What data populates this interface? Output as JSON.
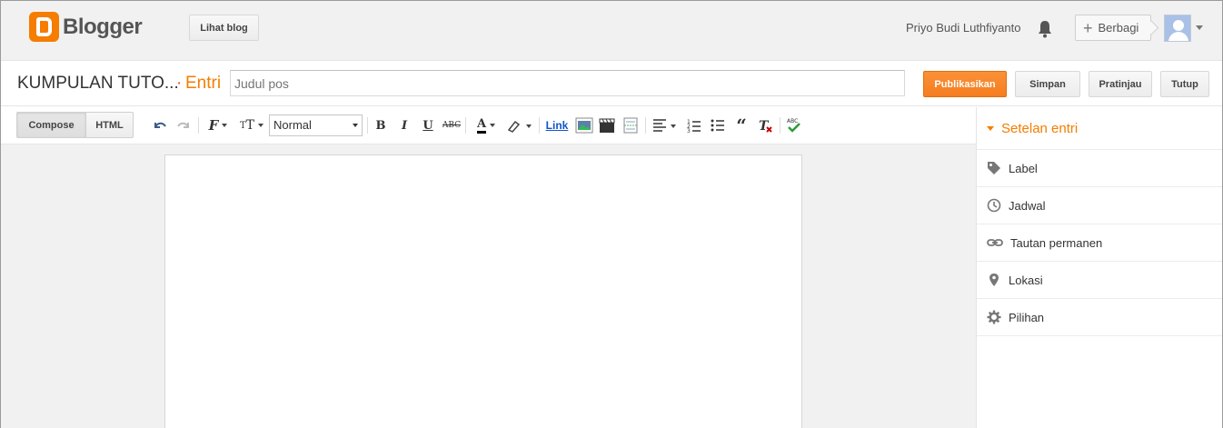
{
  "app": {
    "name": "Blogger"
  },
  "header": {
    "view_blog_label": "Lihat blog",
    "user_name": "Priyo Budi Luthfiyanto",
    "share_label": "Berbagi"
  },
  "post": {
    "blog_name": "KUMPULAN TUTO...",
    "separator": "·",
    "section_label": "Entri",
    "title_placeholder": "Judul pos",
    "publish_label": "Publikasikan",
    "save_label": "Simpan",
    "preview_label": "Pratinjau",
    "close_label": "Tutup"
  },
  "toolbar": {
    "compose_label": "Compose",
    "html_label": "HTML",
    "font_size_value": "Normal",
    "link_label": "Link"
  },
  "sidebar": {
    "title": "Setelan entri",
    "items": [
      {
        "label": "Label",
        "icon": "tag-icon"
      },
      {
        "label": "Jadwal",
        "icon": "clock-icon"
      },
      {
        "label": "Tautan permanen",
        "icon": "link-icon"
      },
      {
        "label": "Lokasi",
        "icon": "location-pin-icon"
      },
      {
        "label": "Pilihan",
        "icon": "gear-icon"
      }
    ]
  },
  "colors": {
    "accent": "#f57d00",
    "publish_button": "#f98b2d"
  }
}
